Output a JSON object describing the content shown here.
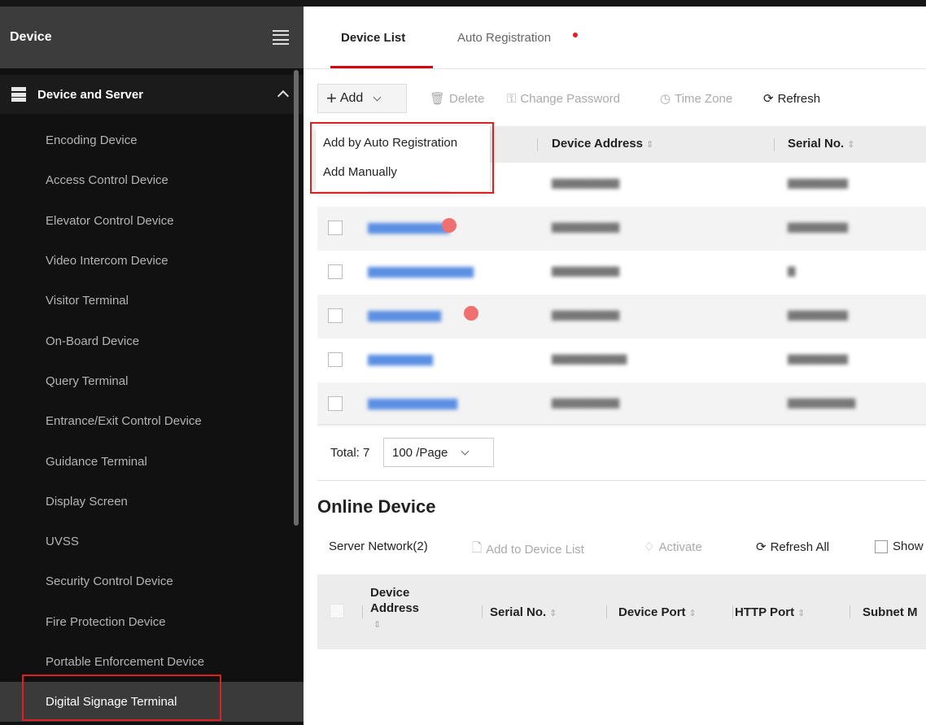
{
  "sidebar": {
    "title": "Device",
    "group": {
      "label": "Device and Server"
    },
    "items": [
      {
        "label": "Encoding Device"
      },
      {
        "label": "Access Control Device"
      },
      {
        "label": "Elevator Control Device"
      },
      {
        "label": "Video Intercom Device"
      },
      {
        "label": "Visitor Terminal"
      },
      {
        "label": "On-Board Device"
      },
      {
        "label": "Query Terminal"
      },
      {
        "label": "Entrance/Exit Control Device"
      },
      {
        "label": "Guidance Terminal"
      },
      {
        "label": "Display Screen"
      },
      {
        "label": "UVSS"
      },
      {
        "label": "Security Control Device"
      },
      {
        "label": "Fire Protection Device"
      },
      {
        "label": "Portable Enforcement Device"
      },
      {
        "label": "Digital Signage Terminal"
      }
    ],
    "selected_item": "Digital Signage Terminal"
  },
  "tabs": [
    {
      "label": "Device List",
      "active": true
    },
    {
      "label": "Auto Registration",
      "notification_dot": true
    }
  ],
  "toolbar": {
    "add_label": "Add",
    "delete_label": "Delete",
    "change_password_label": "Change Password",
    "time_zone_label": "Time Zone",
    "refresh_label": "Refresh"
  },
  "add_menu": {
    "items": [
      "Add by Auto Registration",
      "Add Manually"
    ]
  },
  "device_table": {
    "columns": [
      "Device Address",
      "Serial No."
    ],
    "rows": [
      {
        "name": "▇▇▇▇▇▇▇▇▇▇",
        "address": "▇▇▇▇▇▇▇▇▇",
        "serial": "▇▇▇▇▇▇▇▇"
      },
      {
        "name": "▇▇▇▇▇▇▇▇▇▇",
        "address": "▇▇▇▇▇▇▇▇▇",
        "serial": "▇▇▇▇▇▇▇▇"
      },
      {
        "name": "▇▇▇▇▇▇▇▇▇▇▇▇▇",
        "address": "▇▇▇▇▇▇▇▇▇",
        "serial": "▇"
      },
      {
        "name": "▇▇▇▇▇▇▇▇▇",
        "address": "▇▇▇▇▇▇▇▇▇",
        "serial": "▇▇▇▇▇▇▇▇"
      },
      {
        "name": "▇▇▇▇▇▇▇▇",
        "address": "▇▇▇▇▇▇▇▇▇▇",
        "serial": "▇▇▇▇▇▇▇▇"
      },
      {
        "name": "▇▇▇▇▇▇▇▇▇▇▇",
        "address": "▇▇▇▇▇▇▇▇▇",
        "serial": "▇▇▇▇▇▇▇▇▇"
      }
    ]
  },
  "pagination": {
    "total_label": "Total: 7",
    "page_size": "100 /Page"
  },
  "online_device": {
    "title": "Online Device",
    "server_network": "Server Network(2)",
    "add_to_list_label": "Add to Device List",
    "activate_label": "Activate",
    "refresh_all_label": "Refresh All",
    "show_label": "Show",
    "columns": [
      "Device",
      "Address",
      "Serial No.",
      "Device Port",
      "HTTP Port",
      "Subnet M"
    ]
  },
  "colors": {
    "accent_red": "#d6000f",
    "link_blue": "#5b8fe3",
    "sidebar_bg": "#111111",
    "highlight_outline": "#e02020"
  }
}
